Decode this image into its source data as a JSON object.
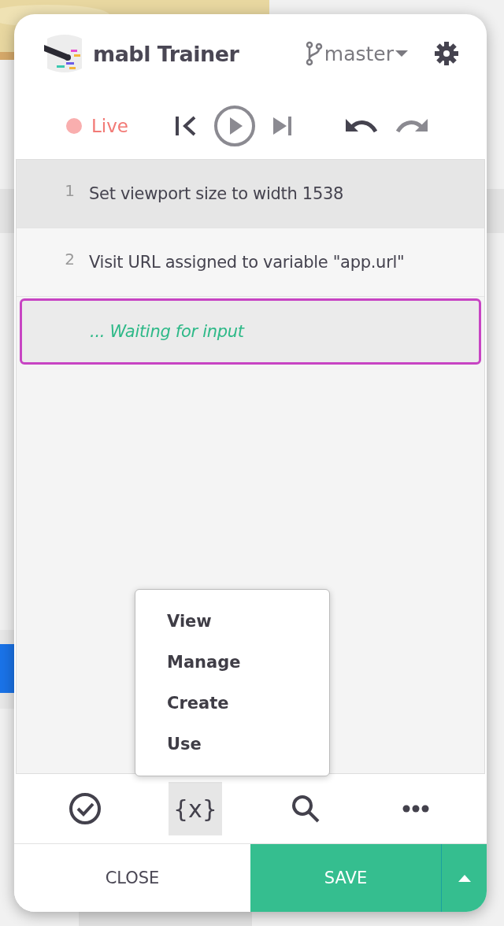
{
  "header": {
    "title": "mabl Trainer",
    "branch": "master"
  },
  "controls": {
    "live": {
      "label": "Live",
      "color": "#f9aeae"
    },
    "buttons": [
      {
        "kind": "first",
        "disabled": false
      },
      {
        "kind": "play",
        "disabled": true
      },
      {
        "kind": "next",
        "disabled": true
      },
      {
        "kind": "undo",
        "disabled": false
      },
      {
        "kind": "redo",
        "disabled": true
      }
    ]
  },
  "steps": [
    {
      "number": "1",
      "text": "Set viewport size to width 1538",
      "selected": true
    },
    {
      "number": "2",
      "text": "Visit URL assigned to variable \"app.url\"",
      "selected": false
    }
  ],
  "waiting": {
    "text": "... Waiting for input"
  },
  "menu": {
    "items": [
      "View",
      "Manage",
      "Create",
      "Use"
    ]
  },
  "toolbar": [
    {
      "kind": "check",
      "selected": false
    },
    {
      "kind": "variables",
      "label": "{x}",
      "selected": true
    },
    {
      "kind": "search",
      "selected": false
    },
    {
      "kind": "more",
      "selected": false
    }
  ],
  "footer": {
    "close": "CLOSE",
    "save": "SAVE"
  }
}
